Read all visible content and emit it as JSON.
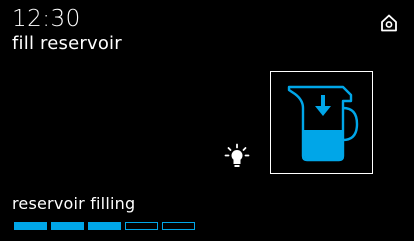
{
  "header": {
    "time": "12:30",
    "title": "fill reservoir",
    "home_icon": "home-icon"
  },
  "main": {
    "jug_icon": "reservoir-fill-icon",
    "light_icon": "light-bulb-icon"
  },
  "footer": {
    "status_text": "reservoir filling",
    "progress": {
      "segments_total": 5,
      "segments_filled": 3
    }
  },
  "colors": {
    "background": "#000000",
    "foreground": "#ffffff",
    "accent": "#00a6e8"
  }
}
